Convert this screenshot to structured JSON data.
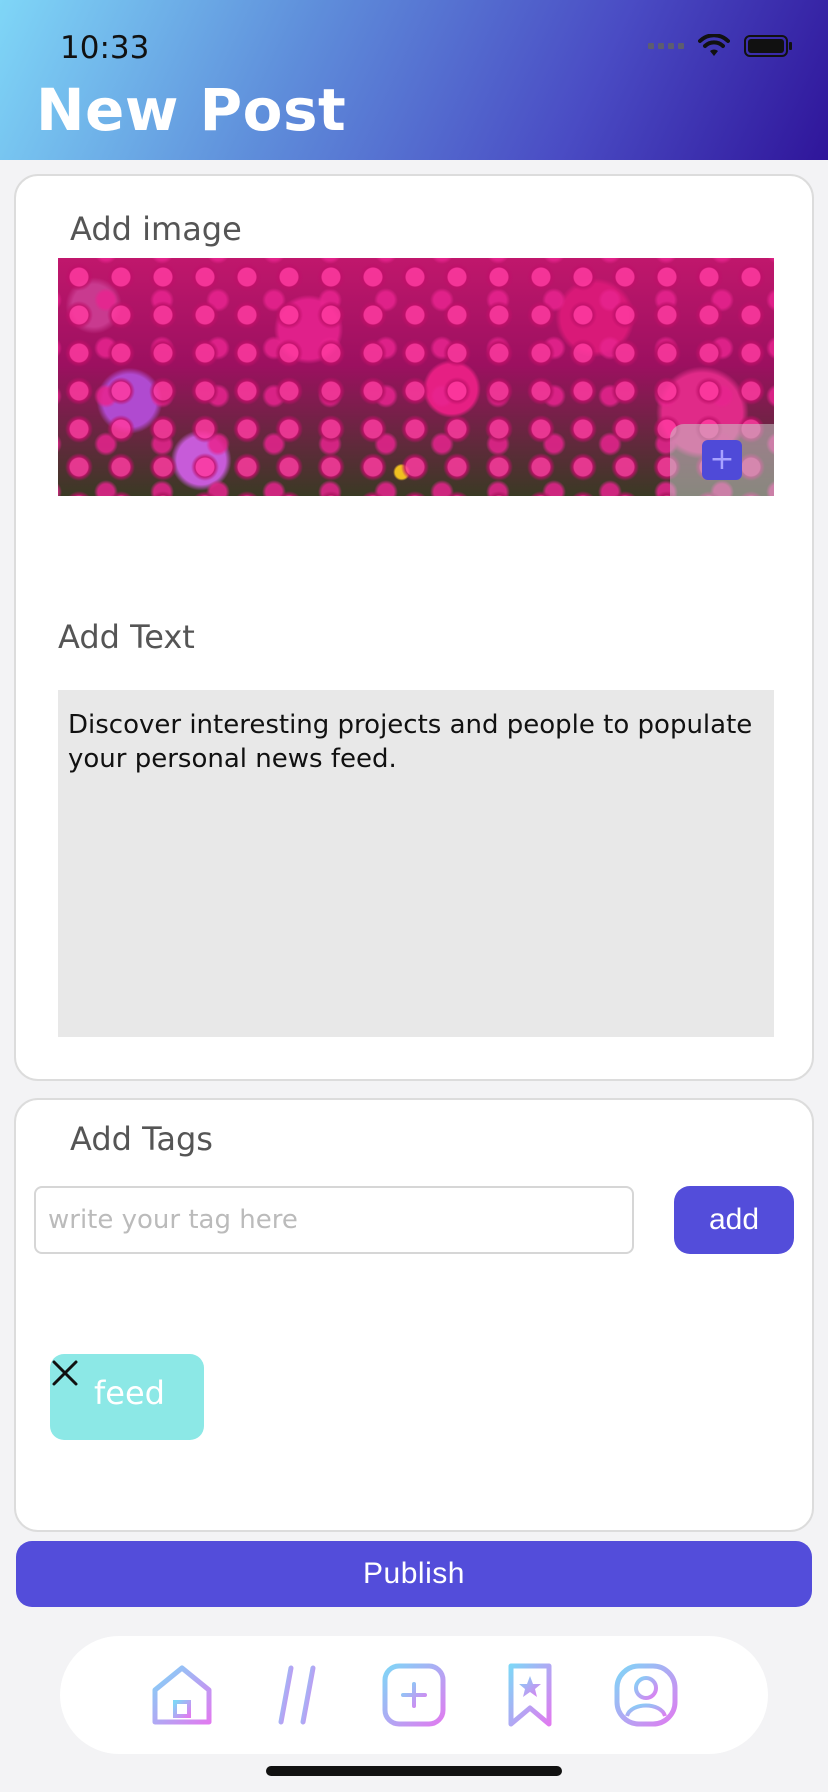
{
  "status_bar": {
    "time": "10:33"
  },
  "header": {
    "title": "New Post"
  },
  "image_section": {
    "label": "Add image"
  },
  "text_section": {
    "label": "Add Text",
    "value": "Discover interesting projects and people to populate your personal news feed."
  },
  "tags_section": {
    "label": "Add Tags",
    "input_placeholder": "write your tag here",
    "add_label": "add",
    "tags": [
      {
        "label": "feed"
      }
    ]
  },
  "publish_label": "Publish",
  "tabbar": {
    "items": [
      {
        "icon": "home-icon"
      },
      {
        "icon": "hashtag-icon"
      },
      {
        "icon": "add-square-icon"
      },
      {
        "icon": "bookmark-star-icon"
      },
      {
        "icon": "profile-icon"
      }
    ]
  },
  "colors": {
    "accent": "#534dda",
    "tag_chip": "#8ce8e6",
    "header_gradient_start": "#7fd6f7",
    "header_gradient_end": "#2f159a"
  }
}
